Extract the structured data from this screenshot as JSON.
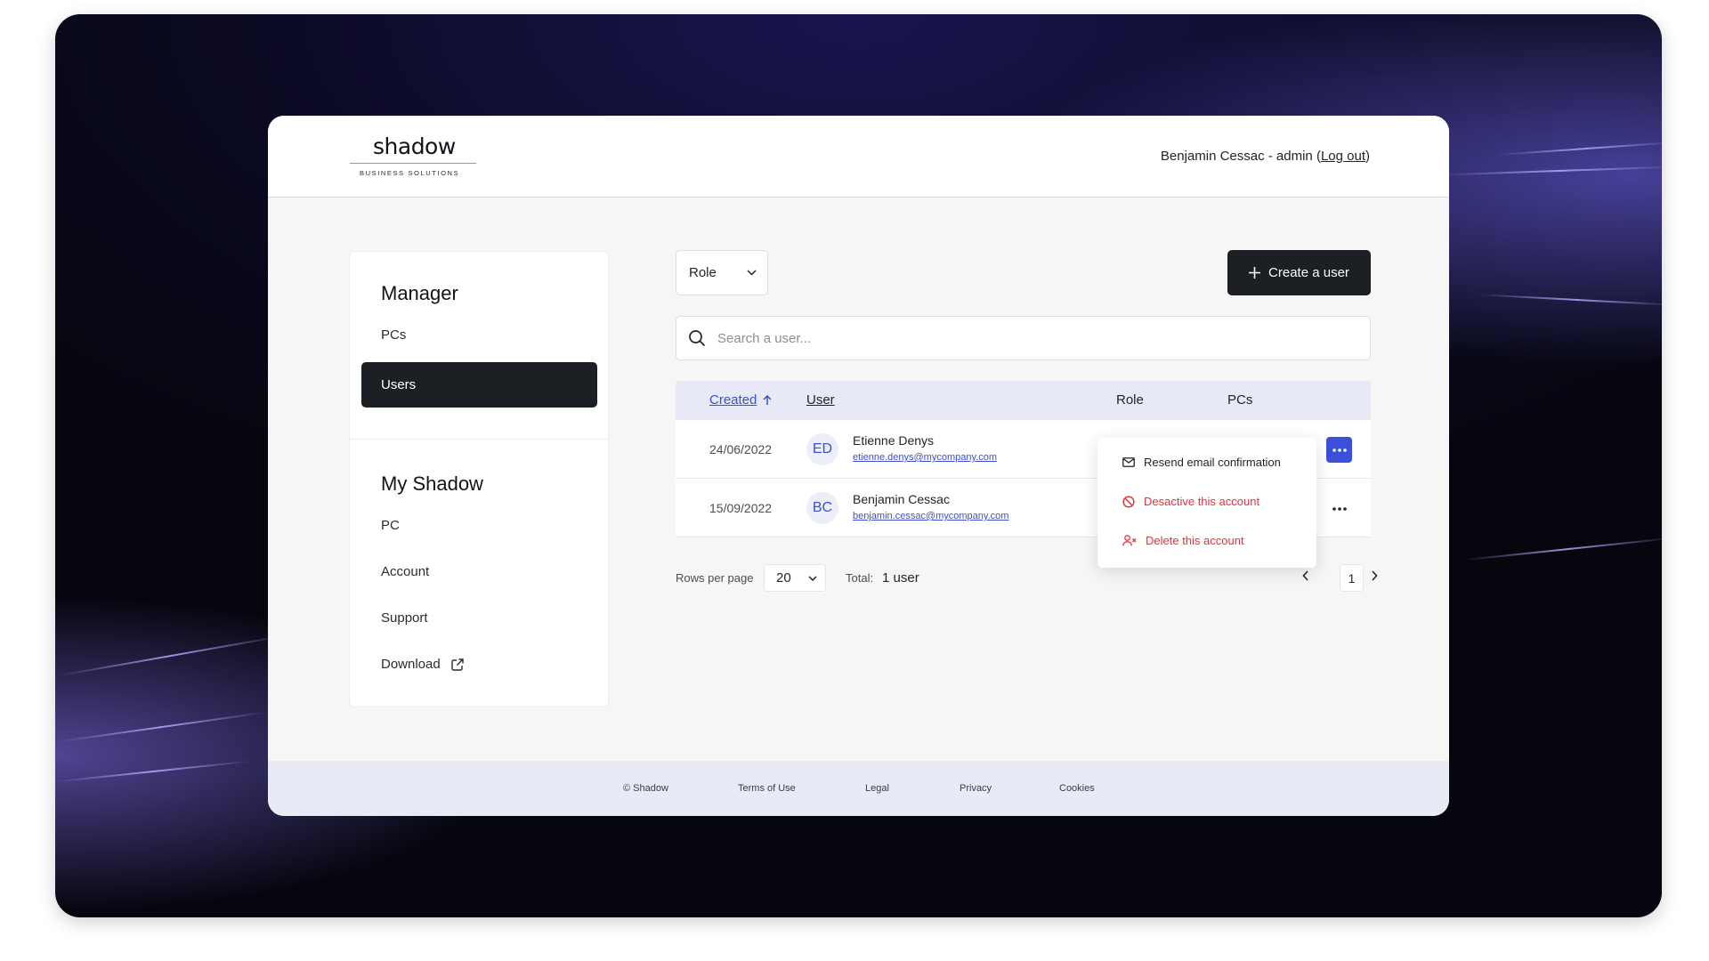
{
  "header": {
    "logo_word": "shadow",
    "logo_sub": "BUSINESS SOLUTIONS",
    "user_text": "Benjamin Cessac - admin (",
    "logout_label": "Log out",
    "user_text_end": ")"
  },
  "sidebar": {
    "manager_title": "Manager",
    "manager_items": [
      {
        "label": "PCs"
      },
      {
        "label": "Users"
      }
    ],
    "my_shadow_title": "My Shadow",
    "my_shadow_items": [
      {
        "label": "PC"
      },
      {
        "label": "Account"
      },
      {
        "label": "Support"
      },
      {
        "label": "Download"
      }
    ]
  },
  "toolbar": {
    "role_filter": "Role",
    "create_label": "Create a user",
    "search_placeholder": "Search a user..."
  },
  "table": {
    "columns": [
      "Created",
      "User",
      "Role",
      "PCs"
    ],
    "rows": [
      {
        "date": "24/06/2022",
        "initials": "ED",
        "name": "Etienne Denys",
        "email": "etienne.denys@mycompany.com"
      },
      {
        "date": "15/09/2022",
        "initials": "BC",
        "name": "Benjamin Cessac",
        "email": "benjamin.cessac@mycompany.com"
      }
    ]
  },
  "menu": {
    "items": [
      {
        "label": "Resend email confirmation"
      },
      {
        "label": "Desactive this account"
      },
      {
        "label": "Delete this account"
      }
    ]
  },
  "pagination": {
    "rows_label": "Rows per page",
    "rows_value": "20",
    "total_label": "Total:",
    "total_value": "1 user",
    "page": "1"
  },
  "footer": {
    "links": [
      "© Shadow",
      "Terms of Use",
      "Legal",
      "Privacy",
      "Cookies"
    ]
  },
  "colors": {
    "accent": "#3f4fcf",
    "dark": "#1c1f24",
    "danger": "#e0323d",
    "table_header": "#e7e9f7"
  }
}
